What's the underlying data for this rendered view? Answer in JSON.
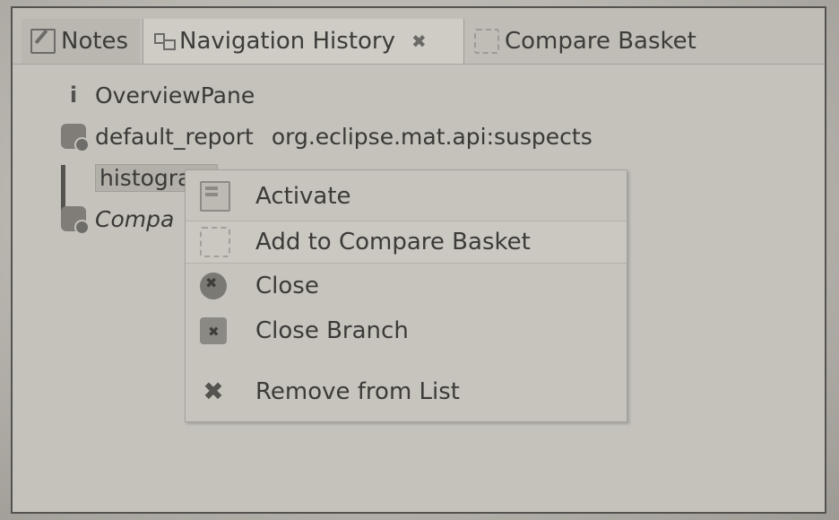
{
  "tabs": [
    {
      "label": "Notes",
      "icon": "notes-icon"
    },
    {
      "label": "Navigation History",
      "icon": "navigation-history-icon",
      "close_glyph": "✖"
    },
    {
      "label": "Compare Basket",
      "icon": "compare-basket-icon"
    }
  ],
  "tree": {
    "items": [
      {
        "label": "OverviewPane",
        "icon": "info-icon"
      },
      {
        "label": "default_report",
        "secondary": "org.eclipse.mat.api:suspects",
        "icon": "report-icon"
      },
      {
        "label": "histogram",
        "icon": "histogram-icon"
      },
      {
        "label": "Compa",
        "icon": "report-icon"
      }
    ]
  },
  "context_menu": {
    "items": [
      {
        "label": "Activate",
        "icon": "activate-icon"
      },
      {
        "label": "Add to Compare Basket",
        "icon": "add-to-basket-icon"
      },
      {
        "label": "Close",
        "icon": "close-icon"
      },
      {
        "label": "Close Branch",
        "icon": "close-branch-icon"
      },
      {
        "label": "Remove from List",
        "icon": "remove-icon"
      }
    ]
  }
}
